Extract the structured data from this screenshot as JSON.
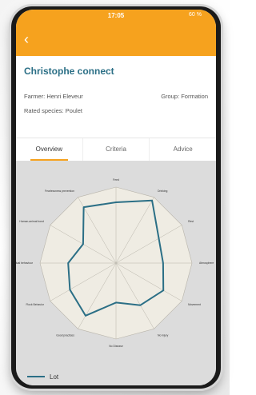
{
  "status": {
    "time": "17:05",
    "right": "60 %"
  },
  "header": {
    "back_icon": "chevron-left-icon"
  },
  "card": {
    "title": "Christophe connect",
    "farmer": "Farmer: Henri Eleveur",
    "group": "Group: Formation",
    "species": "Rated species: Poulet"
  },
  "tabs": [
    {
      "label": "Overview",
      "active": true
    },
    {
      "label": "Criteria",
      "active": false
    },
    {
      "label": "Advice",
      "active": false
    }
  ],
  "legend": {
    "label": "Lot",
    "color": "#2b6f86"
  },
  "chart_data": {
    "type": "radar",
    "axes": [
      "Feed",
      "Drinking",
      "Rest",
      "Atmosphere",
      "Movement",
      "No injury",
      "No Disease",
      "Good practices",
      "Flock Behavior",
      "Individual behaviour",
      "Human-animal bond",
      "Fearlessness prevention"
    ],
    "series": [
      {
        "name": "Lot",
        "values": [
          0.8,
          0.95,
          0.65,
          0.62,
          0.72,
          0.64,
          0.52,
          0.8,
          0.7,
          0.63,
          0.5,
          0.85
        ]
      }
    ],
    "range": [
      0,
      1
    ],
    "grid": true
  }
}
